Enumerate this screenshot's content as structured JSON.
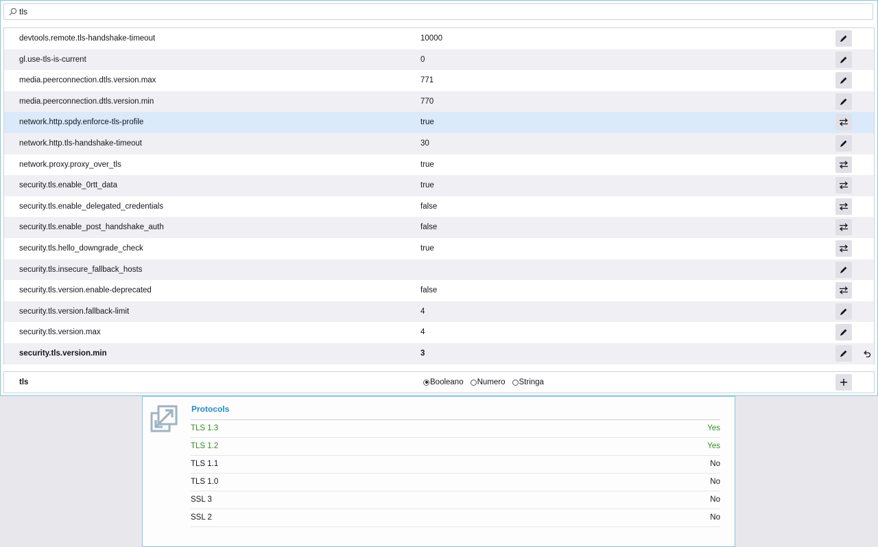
{
  "search": {
    "value": "tls"
  },
  "prefs": [
    {
      "name": "devtools.remote.tls-handshake-timeout",
      "value": "10000",
      "action": "edit"
    },
    {
      "name": "gl.use-tls-is-current",
      "value": "0",
      "action": "edit"
    },
    {
      "name": "media.peerconnection.dtls.version.max",
      "value": "771",
      "action": "edit"
    },
    {
      "name": "media.peerconnection.dtls.version.min",
      "value": "770",
      "action": "edit"
    },
    {
      "name": "network.http.spdy.enforce-tls-profile",
      "value": "true",
      "action": "toggle"
    },
    {
      "name": "network.http.tls-handshake-timeout",
      "value": "30",
      "action": "edit"
    },
    {
      "name": "network.proxy.proxy_over_tls",
      "value": "true",
      "action": "toggle"
    },
    {
      "name": "security.tls.enable_0rtt_data",
      "value": "true",
      "action": "toggle"
    },
    {
      "name": "security.tls.enable_delegated_credentials",
      "value": "false",
      "action": "toggle"
    },
    {
      "name": "security.tls.enable_post_handshake_auth",
      "value": "false",
      "action": "toggle"
    },
    {
      "name": "security.tls.hello_downgrade_check",
      "value": "true",
      "action": "toggle"
    },
    {
      "name": "security.tls.insecure_fallback_hosts",
      "value": "",
      "action": "edit"
    },
    {
      "name": "security.tls.version.enable-deprecated",
      "value": "false",
      "action": "toggle"
    },
    {
      "name": "security.tls.version.fallback-limit",
      "value": "4",
      "action": "edit"
    },
    {
      "name": "security.tls.version.max",
      "value": "4",
      "action": "edit"
    },
    {
      "name": "security.tls.version.min",
      "value": "3",
      "action": "edit",
      "modified": true
    }
  ],
  "new_pref": {
    "name": "tls",
    "types": [
      {
        "label": "Booleano",
        "selected": true
      },
      {
        "label": "Numero",
        "selected": false
      },
      {
        "label": "Stringa",
        "selected": false
      }
    ]
  },
  "protocols": {
    "title": "Protocols",
    "items": [
      {
        "name": "TLS 1.3",
        "value": "Yes",
        "supported": true
      },
      {
        "name": "TLS 1.2",
        "value": "Yes",
        "supported": true
      },
      {
        "name": "TLS 1.1",
        "value": "No",
        "supported": false
      },
      {
        "name": "TLS 1.0",
        "value": "No",
        "supported": false
      },
      {
        "name": "SSL 3",
        "value": "No",
        "supported": false
      },
      {
        "name": "SSL 2",
        "value": "No",
        "supported": false
      }
    ]
  },
  "colors": {
    "accent": "#1c8fc5",
    "supported": "#2f8d1f",
    "highlight_row": "#daeafa",
    "window_border": "#7ec8e0"
  },
  "icons": {
    "search": "search-icon",
    "edit": "pencil-icon",
    "toggle": "toggle-arrows-icon",
    "reset": "undo-icon",
    "add": "plus-icon",
    "protocols": "expand-arrows-icon"
  }
}
